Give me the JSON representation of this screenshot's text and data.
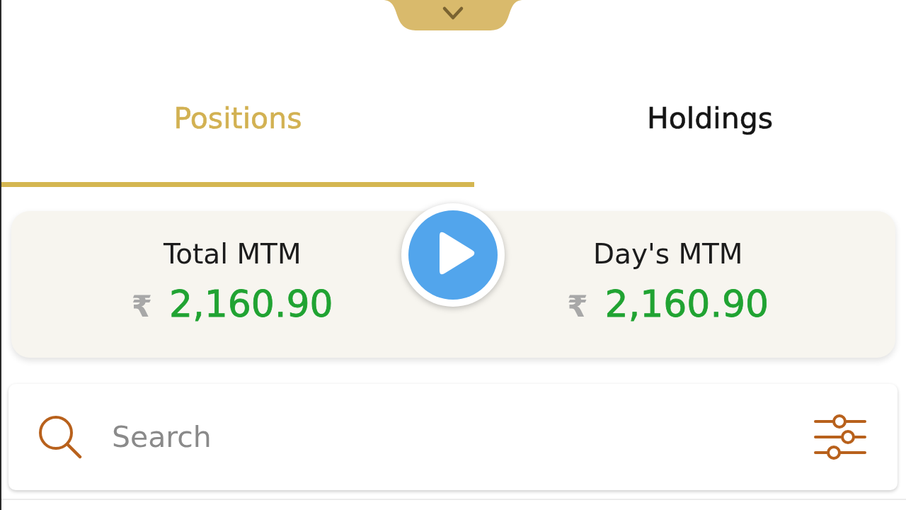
{
  "tabs": [
    {
      "label": "Positions",
      "selected": true
    },
    {
      "label": "Holdings",
      "selected": false
    }
  ],
  "summary": [
    {
      "label": "Total MTM",
      "currency": "₹",
      "value": "2,160.90"
    },
    {
      "label": "Day's MTM",
      "currency": "₹",
      "value": "2,160.90"
    }
  ],
  "search": {
    "placeholder": "Search"
  }
}
